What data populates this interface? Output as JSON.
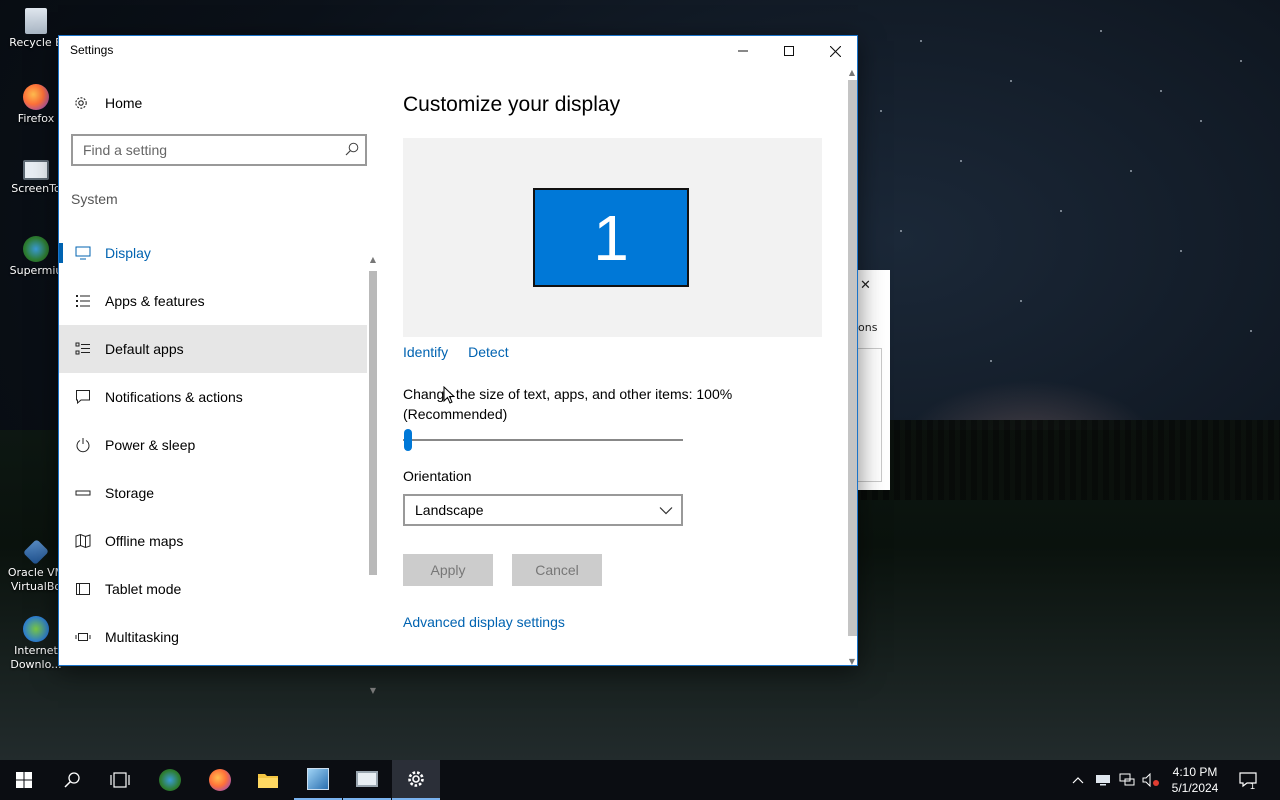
{
  "desktop": {
    "icons": [
      {
        "label": "Recycle B",
        "icon": "recycle-bin-icon"
      },
      {
        "label": "Firefox",
        "icon": "firefox-icon"
      },
      {
        "label": "ScreenTo",
        "icon": "screen-icon"
      },
      {
        "label": "Supermiu",
        "icon": "supermium-icon"
      },
      {
        "label": "Oracle VM VirtualBo",
        "icon": "virtualbox-icon"
      },
      {
        "label": "Internet Downlo...",
        "icon": "internet-download-icon"
      }
    ],
    "background_window": {
      "close": "✕",
      "text": "ons"
    }
  },
  "window": {
    "title": "Settings",
    "controls": {
      "minimize": "—",
      "maximize": "☐",
      "close": "✕"
    }
  },
  "nav": {
    "home_label": "Home",
    "search_placeholder": "Find a setting",
    "section_label": "System",
    "items": [
      {
        "label": "Display",
        "icon": "monitor-icon",
        "state": "active"
      },
      {
        "label": "Apps & features",
        "icon": "list-icon"
      },
      {
        "label": "Default apps",
        "icon": "default-apps-icon",
        "state": "hover"
      },
      {
        "label": "Notifications & actions",
        "icon": "message-icon"
      },
      {
        "label": "Power & sleep",
        "icon": "power-icon"
      },
      {
        "label": "Storage",
        "icon": "storage-icon"
      },
      {
        "label": "Offline maps",
        "icon": "map-icon"
      },
      {
        "label": "Tablet mode",
        "icon": "tablet-icon"
      },
      {
        "label": "Multitasking",
        "icon": "multitasking-icon"
      }
    ]
  },
  "main": {
    "title": "Customize your display",
    "monitor_number": "1",
    "identify_label": "Identify",
    "detect_label": "Detect",
    "scale_label": "Change the size of text, apps, and other items: 100% (Recommended)",
    "scale_value_percent": 100,
    "orientation_label": "Orientation",
    "orientation_value": "Landscape",
    "apply_label": "Apply",
    "cancel_label": "Cancel",
    "advanced_link": "Advanced display settings"
  },
  "taskbar": {
    "apps": [
      "start-icon",
      "search-icon",
      "task-view-icon",
      "supermium-icon",
      "firefox-icon",
      "file-explorer-icon",
      "xp-icon",
      "screen-icon",
      "settings-icon"
    ],
    "active_app": "settings-icon",
    "time": "4:10 PM",
    "date": "5/1/2024",
    "notification_count": "1",
    "accent": "#0078d7"
  }
}
